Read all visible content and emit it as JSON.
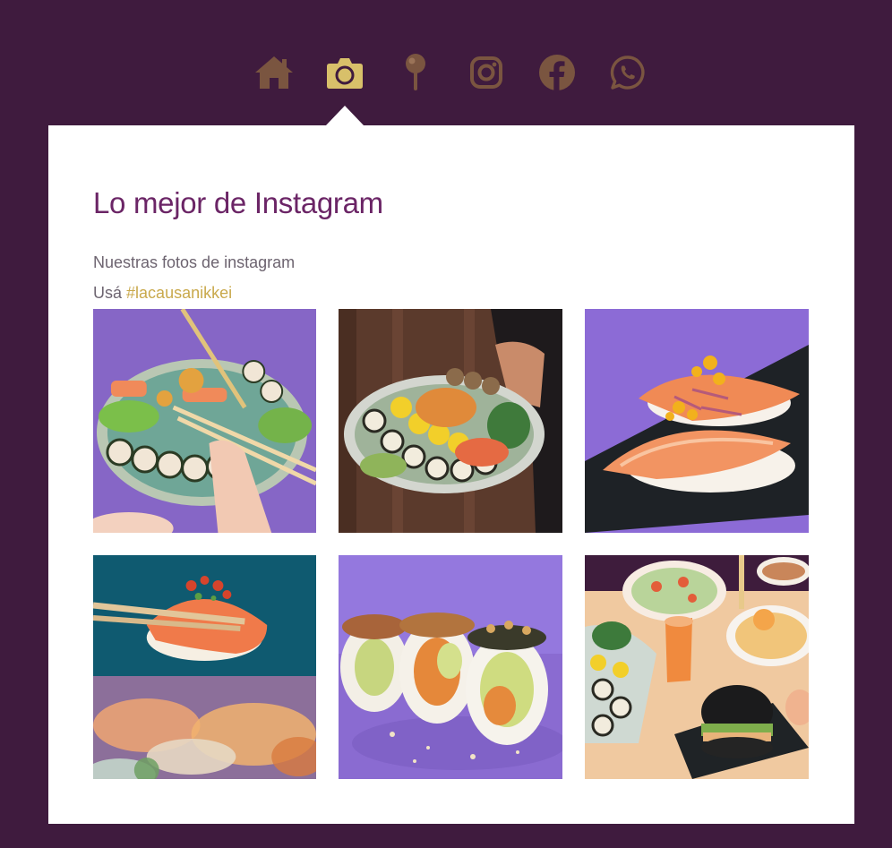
{
  "nav": {
    "items": [
      {
        "icon": "home-icon",
        "active": false
      },
      {
        "icon": "camera-icon",
        "active": true
      },
      {
        "icon": "map-pin-icon",
        "active": false
      },
      {
        "icon": "instagram-icon",
        "active": false
      },
      {
        "icon": "facebook-icon",
        "active": false
      },
      {
        "icon": "whatsapp-icon",
        "active": false
      }
    ],
    "colors": {
      "inactive": "#7a5540",
      "active": "#d8c06a"
    }
  },
  "section": {
    "title": "Lo mejor de Instagram",
    "subtitle": "Nuestras fotos de instagram",
    "hashtag_prefix": "Usá",
    "hashtag": "#lacausanikkei"
  },
  "colors": {
    "background": "#3f1b3e",
    "panel": "#ffffff",
    "title": "#6b2566",
    "hashtag": "#c9a94c"
  },
  "gallery": {
    "photos": [
      {
        "name": "sushi-platter-with-chopsticks"
      },
      {
        "name": "sushi-platter-held-by-hand"
      },
      {
        "name": "salmon-nigiri-on-slate"
      },
      {
        "name": "nigiri-held-with-chopsticks"
      },
      {
        "name": "sushi-rolls-on-purple"
      },
      {
        "name": "table-spread-with-burger"
      }
    ]
  }
}
